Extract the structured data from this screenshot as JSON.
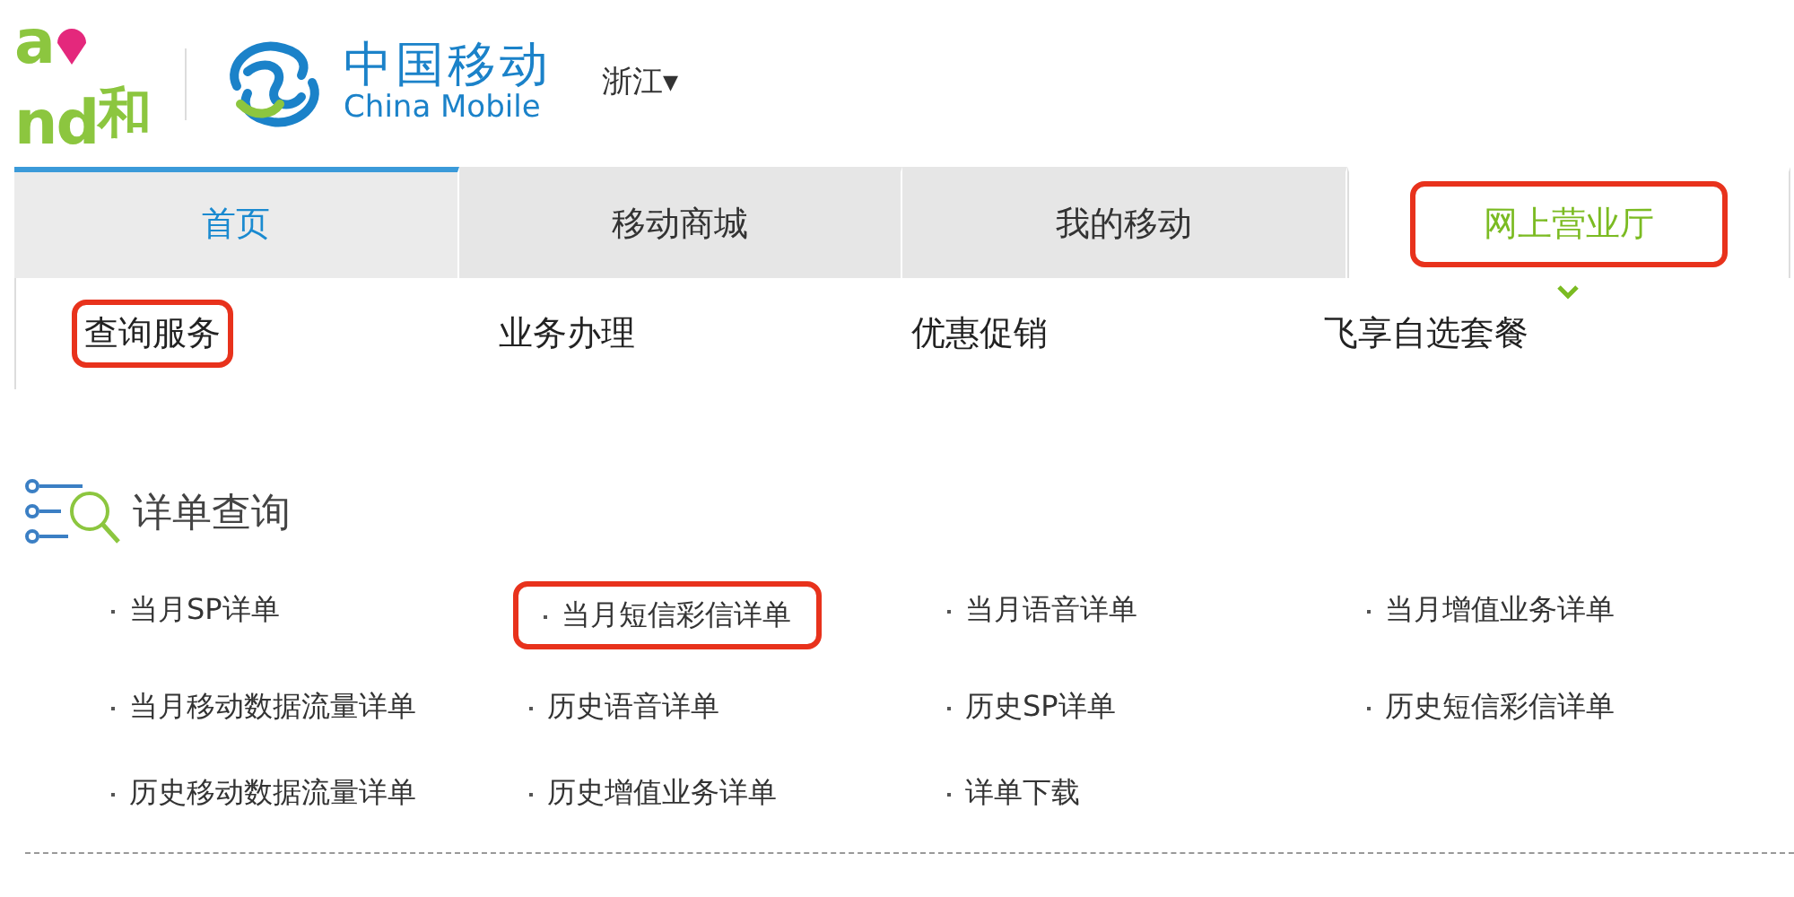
{
  "header": {
    "brand_letters": [
      "a",
      "nd"
    ],
    "brand_name": "和",
    "logo_cn": "中国移动",
    "logo_en": "China Mobile",
    "region": "浙江",
    "region_caret": "▾"
  },
  "tabs": [
    {
      "label": "首页",
      "kind": "home",
      "selected": false,
      "highlighted": false
    },
    {
      "label": "移动商城",
      "kind": "section",
      "selected": false,
      "highlighted": false
    },
    {
      "label": "我的移动",
      "kind": "section",
      "selected": false,
      "highlighted": false
    },
    {
      "label": "网上营业厅",
      "kind": "section",
      "selected": true,
      "highlighted": true
    }
  ],
  "subnav": [
    {
      "label": "查询服务",
      "highlighted": true
    },
    {
      "label": "业务办理",
      "highlighted": false
    },
    {
      "label": "优惠促销",
      "highlighted": false
    },
    {
      "label": "飞享自选套餐",
      "highlighted": false
    }
  ],
  "section": {
    "title": "详单查询",
    "links": [
      {
        "label": "当月SP详单",
        "highlighted": false
      },
      {
        "label": "当月短信彩信详单",
        "highlighted": true
      },
      {
        "label": "当月语音详单",
        "highlighted": false
      },
      {
        "label": "当月增值业务详单",
        "highlighted": false
      },
      {
        "label": "当月移动数据流量详单",
        "highlighted": false
      },
      {
        "label": "历史语音详单",
        "highlighted": false
      },
      {
        "label": "历史SP详单",
        "highlighted": false
      },
      {
        "label": "历史短信彩信详单",
        "highlighted": false
      },
      {
        "label": "历史移动数据流量详单",
        "highlighted": false
      },
      {
        "label": "历史增值业务详单",
        "highlighted": false
      },
      {
        "label": "详单下载",
        "highlighted": false
      }
    ]
  }
}
